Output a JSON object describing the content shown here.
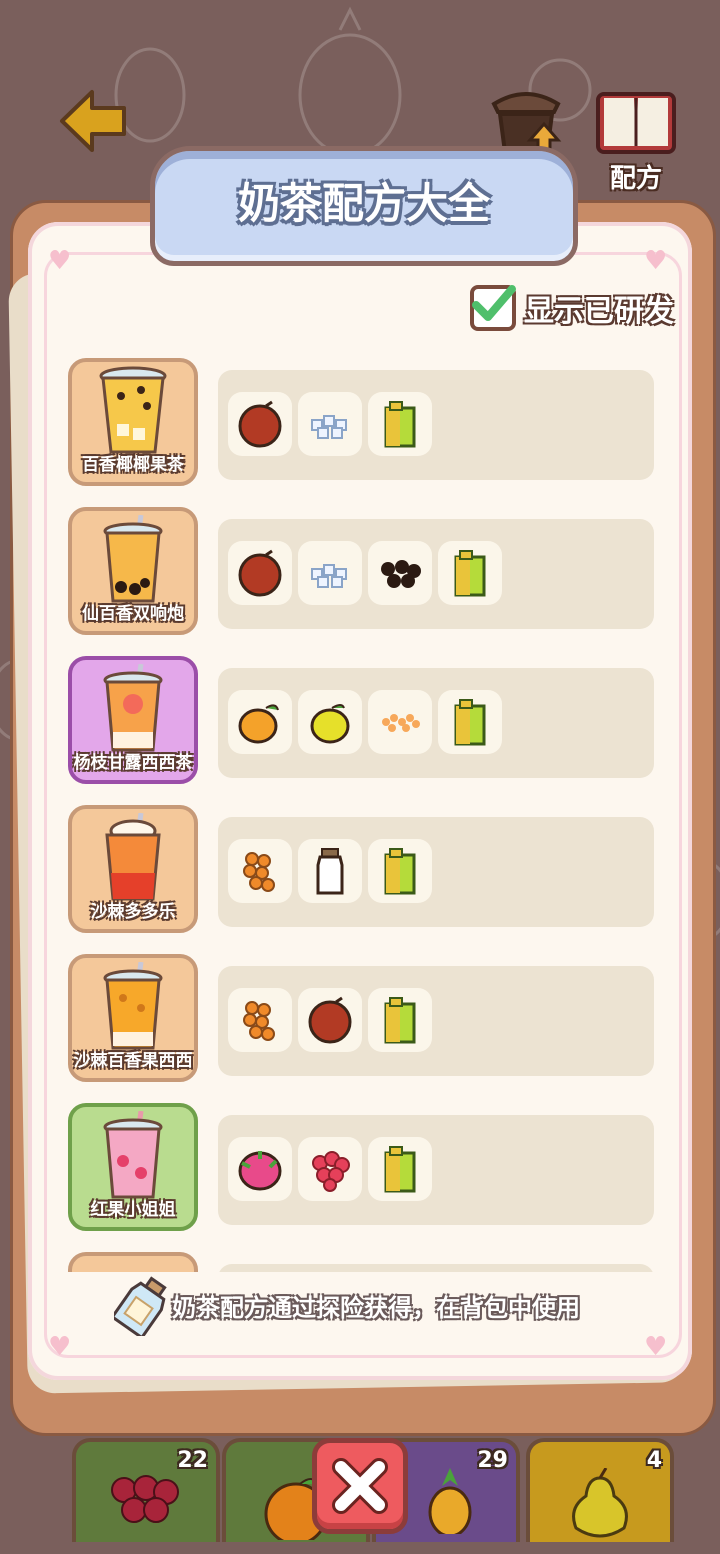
{
  "header": {
    "title": "奶茶配方大全",
    "upgrade_label": "升级",
    "recipe_label": "配方"
  },
  "toggle": {
    "label": "显示已研发",
    "checked": true
  },
  "recipes": [
    {
      "name": "百香椰椰果茶",
      "bg": "#f4c89a",
      "ingredients": [
        "passion-fruit-icon",
        "coconut-jelly-icon",
        "juice-box-icon"
      ]
    },
    {
      "name": "仙百香双响炮",
      "bg": "#f4c89a",
      "ingredients": [
        "passion-fruit-icon",
        "coconut-jelly-icon",
        "tapioca-pearls-icon",
        "juice-box-icon"
      ]
    },
    {
      "name": "杨枝甘露西西茶",
      "bg": "#e3a7ea",
      "ingredients": [
        "mango-icon",
        "lemon-icon",
        "sago-icon",
        "juice-box-icon"
      ]
    },
    {
      "name": "沙棘多多乐",
      "bg": "#f4c89a",
      "ingredients": [
        "sea-buckthorn-icon",
        "milk-bottle-icon",
        "juice-box-icon"
      ]
    },
    {
      "name": "沙棘百香果西西",
      "bg": "#f4c89a",
      "ingredients": [
        "sea-buckthorn-icon",
        "passion-fruit-icon",
        "juice-box-icon"
      ]
    },
    {
      "name": "红果小姐姐",
      "bg": "#b9dc8f",
      "ingredients": [
        "dragon-fruit-icon",
        "raspberry-icon",
        "juice-box-icon"
      ]
    }
  ],
  "hint": "奶茶配方通过探险获得，在背包中使用",
  "inventory": [
    {
      "icon": "grape-icon",
      "count": "22"
    },
    {
      "icon": "orange-icon",
      "count": ""
    },
    {
      "icon": "pineapple-icon",
      "count": "29"
    },
    {
      "icon": "pear-icon",
      "count": "4"
    }
  ],
  "colors": {
    "card_frame": "#c78b66",
    "title_tab": "#c9d8f3",
    "panel": "#ece3d2",
    "close_button": "#ee5b5f"
  }
}
